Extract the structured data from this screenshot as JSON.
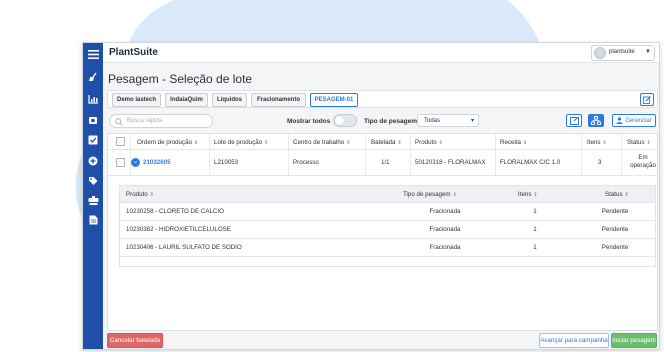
{
  "app": {
    "brand": "PlantSuite",
    "user": "plantsuite"
  },
  "page": {
    "title": "Pesagem - Seleção de lote"
  },
  "tabs": [
    {
      "label": "Demo lastech",
      "active": false
    },
    {
      "label": "IndaiaQuim",
      "active": false
    },
    {
      "label": "Líquidos",
      "active": false
    },
    {
      "label": "Fracionamento",
      "active": false
    },
    {
      "label": "PESAGEM-01",
      "active": true
    }
  ],
  "filters": {
    "search_placeholder": "Busca rápida",
    "show_all_label": "Mostrar todos",
    "show_all_on": false,
    "weighing_type_label": "Tipo de pesagem",
    "weighing_type_value": "Todas",
    "manage_label": "Gerenciar"
  },
  "table": {
    "headers": [
      "Ordem de produção",
      "Lote de produção",
      "Centro de trabalho",
      "Batelada",
      "Produto",
      "Receita",
      "Itens",
      "Status"
    ],
    "rows": [
      {
        "order": "21032605",
        "lot": "L210053",
        "work_center": "Processo",
        "batch": "1/1",
        "product": "50120318 - FLORALMAX",
        "recipe": "FLORALMAX C/C 1.0",
        "items": "3",
        "status": "Em operação"
      }
    ]
  },
  "subtable": {
    "headers": [
      "Produto",
      "Tipo de pesagem",
      "Itens",
      "Status"
    ],
    "rows": [
      {
        "product": "10230258 - CLORETO DE CALCIO",
        "type": "Fracionada",
        "items": "1",
        "status": "Pendente"
      },
      {
        "product": "10230382 - HIDROXIETILCELULOSE",
        "type": "Fracionada",
        "items": "1",
        "status": "Pendente"
      },
      {
        "product": "10230406 - LAURIL SULFATO DE SODIO",
        "type": "Fracionada",
        "items": "1",
        "status": "Pendente"
      }
    ]
  },
  "actions": {
    "cancel": "Cancelar batelada",
    "advance": "Avançar para campanha",
    "start": "Iniciar pesagem"
  },
  "icons": {
    "rail": [
      "menu-icon",
      "broom-icon",
      "chart-icon",
      "scale-icon",
      "check-icon",
      "plus-circle-icon",
      "tag-icon",
      "scale-alt-icon",
      "document-icon"
    ]
  },
  "colors": {
    "primary": "#2c7be5",
    "rail": "#1f4fa8",
    "cancel": "#e06666",
    "start": "#6cc06d",
    "blob": "#dbeaf8"
  }
}
